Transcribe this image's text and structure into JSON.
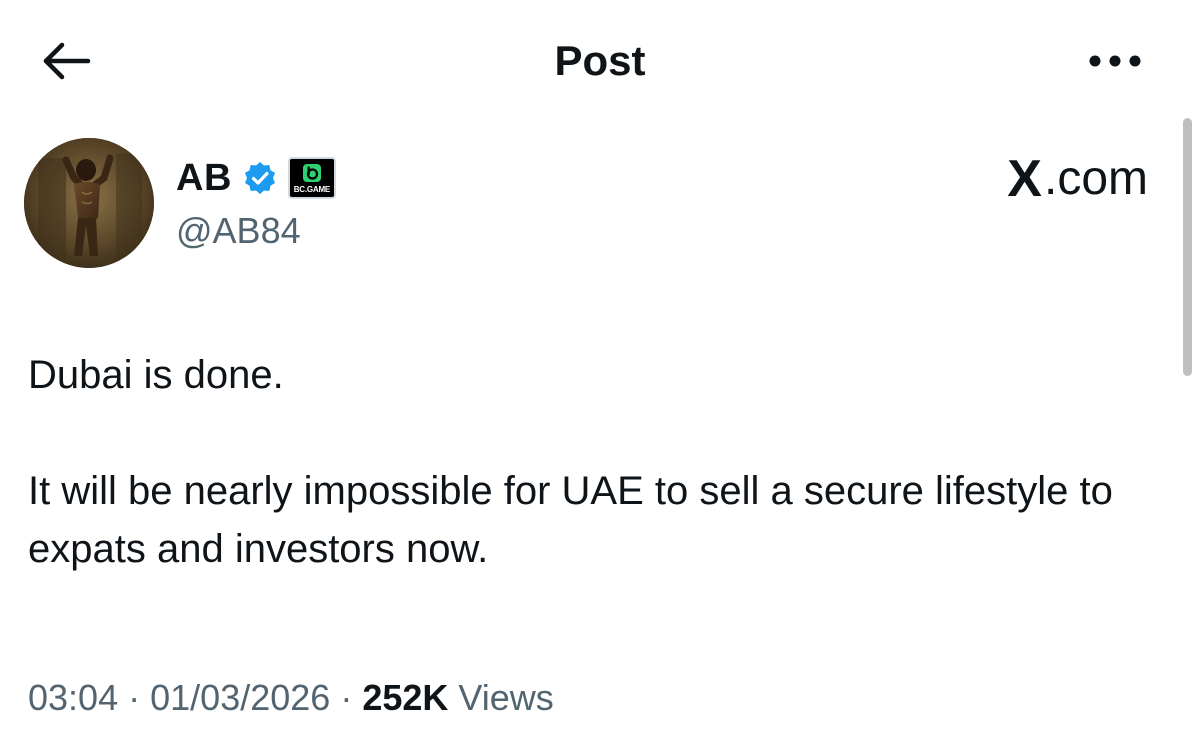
{
  "header": {
    "title": "Post",
    "back_icon": "arrow-left-icon",
    "more_icon": "more-horizontal-icon"
  },
  "post": {
    "author": {
      "name": "AB",
      "handle": "@AB84",
      "verified": true,
      "verified_color": "#1d9bf0",
      "affiliate_badge_text": "BC.GAME",
      "affiliate_badge_color": "#2bd26f"
    },
    "watermark": {
      "x": "X",
      "domain": ".com"
    },
    "text": {
      "line1": "Dubai is done.",
      "line2": "It will be nearly impossible for UAE to sell a secure lifestyle to expats and investors now."
    },
    "meta": {
      "time": "03:04",
      "separator": "·",
      "date": "01/03/2026",
      "views_count": "252K",
      "views_label": "Views"
    }
  },
  "colors": {
    "text": "#0f1419",
    "secondary": "#536471",
    "background": "#ffffff"
  }
}
